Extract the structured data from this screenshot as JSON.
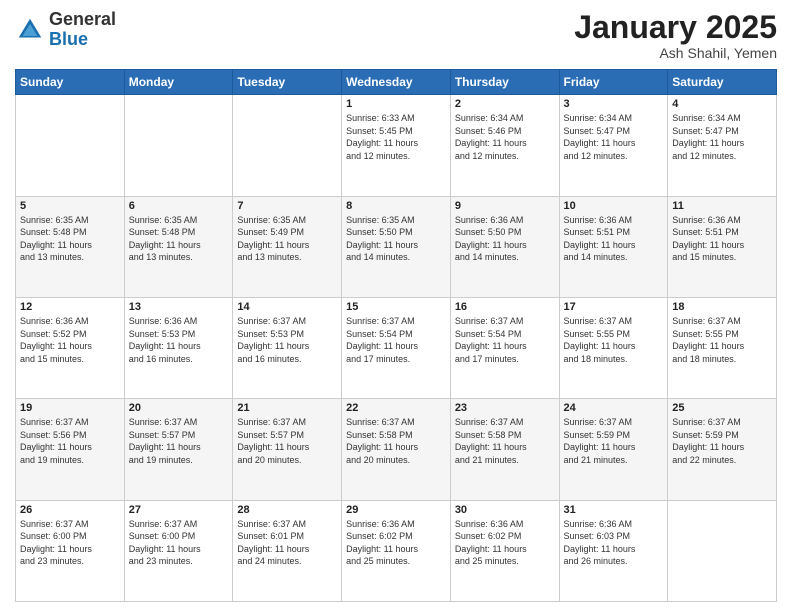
{
  "logo": {
    "general": "General",
    "blue": "Blue"
  },
  "header": {
    "month": "January 2025",
    "location": "Ash Shahil, Yemen"
  },
  "weekdays": [
    "Sunday",
    "Monday",
    "Tuesday",
    "Wednesday",
    "Thursday",
    "Friday",
    "Saturday"
  ],
  "weeks": [
    [
      {
        "day": "",
        "info": ""
      },
      {
        "day": "",
        "info": ""
      },
      {
        "day": "",
        "info": ""
      },
      {
        "day": "1",
        "info": "Sunrise: 6:33 AM\nSunset: 5:45 PM\nDaylight: 11 hours\nand 12 minutes."
      },
      {
        "day": "2",
        "info": "Sunrise: 6:34 AM\nSunset: 5:46 PM\nDaylight: 11 hours\nand 12 minutes."
      },
      {
        "day": "3",
        "info": "Sunrise: 6:34 AM\nSunset: 5:47 PM\nDaylight: 11 hours\nand 12 minutes."
      },
      {
        "day": "4",
        "info": "Sunrise: 6:34 AM\nSunset: 5:47 PM\nDaylight: 11 hours\nand 12 minutes."
      }
    ],
    [
      {
        "day": "5",
        "info": "Sunrise: 6:35 AM\nSunset: 5:48 PM\nDaylight: 11 hours\nand 13 minutes."
      },
      {
        "day": "6",
        "info": "Sunrise: 6:35 AM\nSunset: 5:48 PM\nDaylight: 11 hours\nand 13 minutes."
      },
      {
        "day": "7",
        "info": "Sunrise: 6:35 AM\nSunset: 5:49 PM\nDaylight: 11 hours\nand 13 minutes."
      },
      {
        "day": "8",
        "info": "Sunrise: 6:35 AM\nSunset: 5:50 PM\nDaylight: 11 hours\nand 14 minutes."
      },
      {
        "day": "9",
        "info": "Sunrise: 6:36 AM\nSunset: 5:50 PM\nDaylight: 11 hours\nand 14 minutes."
      },
      {
        "day": "10",
        "info": "Sunrise: 6:36 AM\nSunset: 5:51 PM\nDaylight: 11 hours\nand 14 minutes."
      },
      {
        "day": "11",
        "info": "Sunrise: 6:36 AM\nSunset: 5:51 PM\nDaylight: 11 hours\nand 15 minutes."
      }
    ],
    [
      {
        "day": "12",
        "info": "Sunrise: 6:36 AM\nSunset: 5:52 PM\nDaylight: 11 hours\nand 15 minutes."
      },
      {
        "day": "13",
        "info": "Sunrise: 6:36 AM\nSunset: 5:53 PM\nDaylight: 11 hours\nand 16 minutes."
      },
      {
        "day": "14",
        "info": "Sunrise: 6:37 AM\nSunset: 5:53 PM\nDaylight: 11 hours\nand 16 minutes."
      },
      {
        "day": "15",
        "info": "Sunrise: 6:37 AM\nSunset: 5:54 PM\nDaylight: 11 hours\nand 17 minutes."
      },
      {
        "day": "16",
        "info": "Sunrise: 6:37 AM\nSunset: 5:54 PM\nDaylight: 11 hours\nand 17 minutes."
      },
      {
        "day": "17",
        "info": "Sunrise: 6:37 AM\nSunset: 5:55 PM\nDaylight: 11 hours\nand 18 minutes."
      },
      {
        "day": "18",
        "info": "Sunrise: 6:37 AM\nSunset: 5:55 PM\nDaylight: 11 hours\nand 18 minutes."
      }
    ],
    [
      {
        "day": "19",
        "info": "Sunrise: 6:37 AM\nSunset: 5:56 PM\nDaylight: 11 hours\nand 19 minutes."
      },
      {
        "day": "20",
        "info": "Sunrise: 6:37 AM\nSunset: 5:57 PM\nDaylight: 11 hours\nand 19 minutes."
      },
      {
        "day": "21",
        "info": "Sunrise: 6:37 AM\nSunset: 5:57 PM\nDaylight: 11 hours\nand 20 minutes."
      },
      {
        "day": "22",
        "info": "Sunrise: 6:37 AM\nSunset: 5:58 PM\nDaylight: 11 hours\nand 20 minutes."
      },
      {
        "day": "23",
        "info": "Sunrise: 6:37 AM\nSunset: 5:58 PM\nDaylight: 11 hours\nand 21 minutes."
      },
      {
        "day": "24",
        "info": "Sunrise: 6:37 AM\nSunset: 5:59 PM\nDaylight: 11 hours\nand 21 minutes."
      },
      {
        "day": "25",
        "info": "Sunrise: 6:37 AM\nSunset: 5:59 PM\nDaylight: 11 hours\nand 22 minutes."
      }
    ],
    [
      {
        "day": "26",
        "info": "Sunrise: 6:37 AM\nSunset: 6:00 PM\nDaylight: 11 hours\nand 23 minutes."
      },
      {
        "day": "27",
        "info": "Sunrise: 6:37 AM\nSunset: 6:00 PM\nDaylight: 11 hours\nand 23 minutes."
      },
      {
        "day": "28",
        "info": "Sunrise: 6:37 AM\nSunset: 6:01 PM\nDaylight: 11 hours\nand 24 minutes."
      },
      {
        "day": "29",
        "info": "Sunrise: 6:36 AM\nSunset: 6:02 PM\nDaylight: 11 hours\nand 25 minutes."
      },
      {
        "day": "30",
        "info": "Sunrise: 6:36 AM\nSunset: 6:02 PM\nDaylight: 11 hours\nand 25 minutes."
      },
      {
        "day": "31",
        "info": "Sunrise: 6:36 AM\nSunset: 6:03 PM\nDaylight: 11 hours\nand 26 minutes."
      },
      {
        "day": "",
        "info": ""
      }
    ]
  ]
}
